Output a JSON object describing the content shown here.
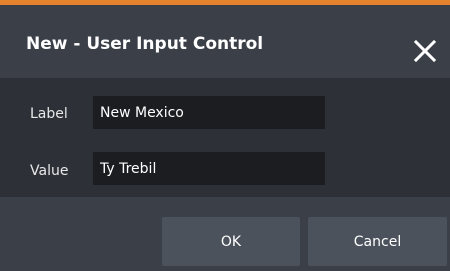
{
  "dialog": {
    "title": "New - User Input Control",
    "close_icon": "close-icon",
    "accent_color": "#e5822d"
  },
  "fields": [
    {
      "label": "Label",
      "value": "New Mexico"
    },
    {
      "label": "Value",
      "value": "Ty Trebil"
    }
  ],
  "buttons": {
    "ok_label": "OK",
    "cancel_label": "Cancel"
  }
}
